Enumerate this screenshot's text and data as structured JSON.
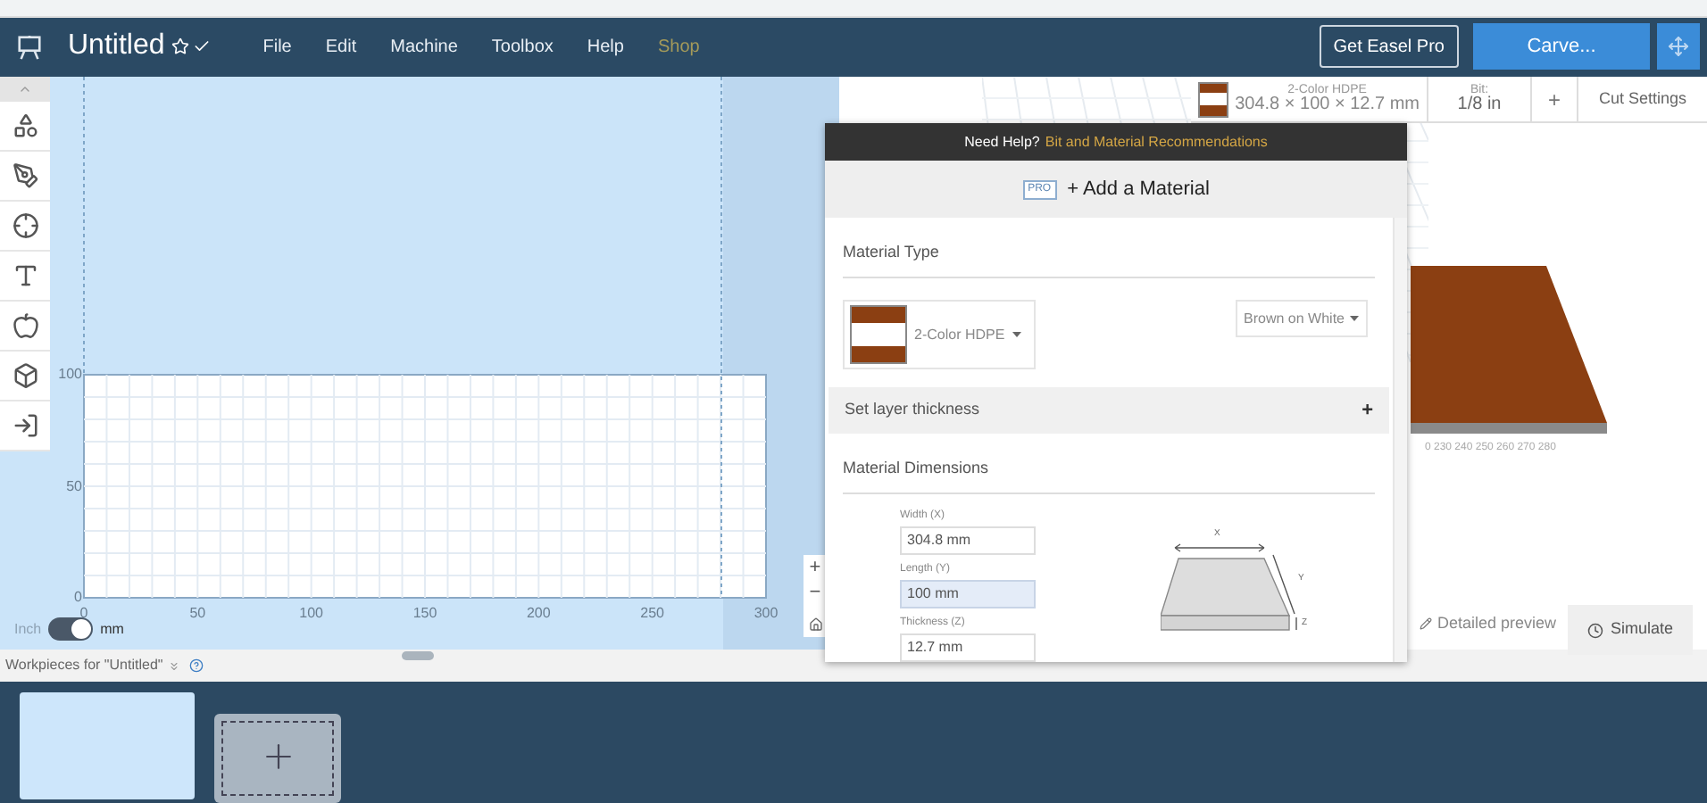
{
  "header": {
    "title": "Untitled",
    "menu": [
      {
        "label": "File",
        "kind": "menu"
      },
      {
        "label": "Edit",
        "kind": "menu"
      },
      {
        "label": "Machine",
        "kind": "menu"
      },
      {
        "label": "Toolbox",
        "kind": "menu"
      },
      {
        "label": "Help",
        "kind": "menu"
      },
      {
        "label": "Shop",
        "kind": "shop"
      }
    ],
    "pro_button": "Get Easel Pro",
    "carve_button": "Carve..."
  },
  "canvas": {
    "y_labels": [
      "100",
      "50",
      "0"
    ],
    "x_labels": [
      "0",
      "50",
      "100",
      "150",
      "200",
      "250",
      "300"
    ],
    "unit_toggle": {
      "left": "Inch",
      "right": "mm",
      "metric": true
    },
    "zoom_in": "+",
    "zoom_out": "−"
  },
  "toolbar": {
    "material_name": "2-Color HDPE",
    "material_size": "304.8 × 100 × 12.7 mm",
    "bit_label": "Bit:",
    "bit_value": "1/8 in",
    "add": "+",
    "cut_settings": "Cut Settings"
  },
  "preview": {
    "axis_labels": "0 230 240 250 260 270 280",
    "detailed_preview": "Detailed preview",
    "simulate": "Simulate"
  },
  "material_panel": {
    "help_prefix": "Need Help?",
    "help_link": "Bit and Material Recommendations",
    "pro_badge": "PRO",
    "add_material": "+ Add a Material",
    "material_type_heading": "Material Type",
    "material": "2-Color HDPE",
    "color_option": "Brown on White",
    "layer_thickness": "Set layer thickness",
    "layer_toggle": "+",
    "dimensions_heading": "Material Dimensions",
    "fields": [
      {
        "label": "Width (X)",
        "value": "304.8 mm",
        "focused": false
      },
      {
        "label": "Length (Y)",
        "value": "100 mm",
        "focused": true
      },
      {
        "label": "Thickness (Z)",
        "value": "12.7 mm",
        "focused": false
      }
    ],
    "diagram_labels": {
      "x": "X",
      "y": "Y",
      "z": "Z"
    }
  },
  "workpieces": {
    "title": "Workpieces for \"Untitled\""
  }
}
